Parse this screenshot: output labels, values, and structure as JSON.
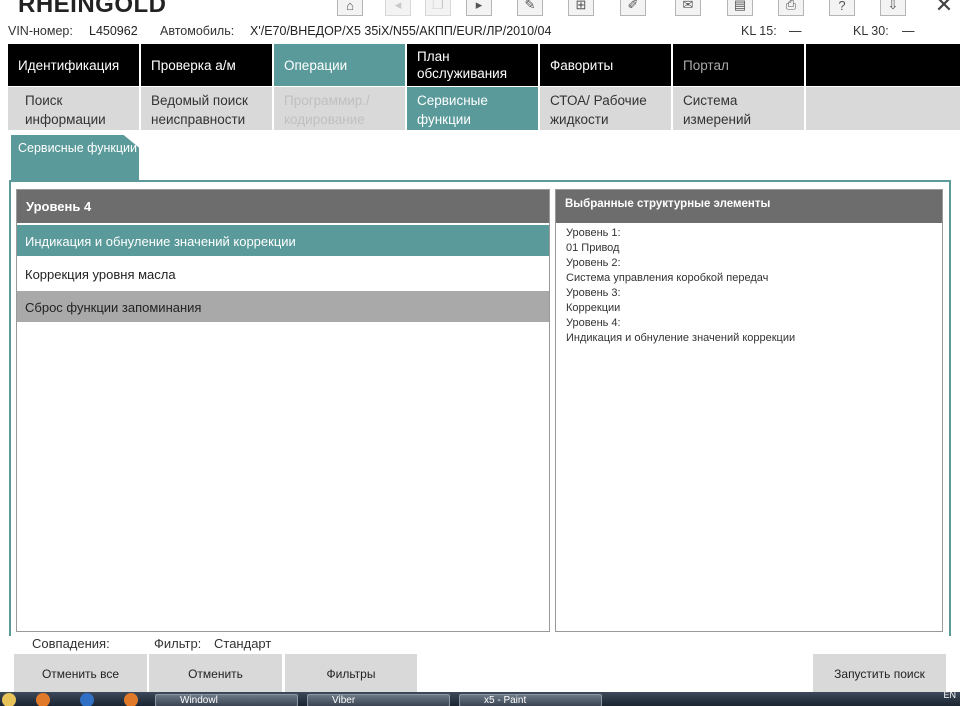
{
  "app": {
    "title": "RHEINGOLD"
  },
  "toolbar": {
    "buttons": [
      {
        "name": "home-icon",
        "glyph": "⌂"
      },
      {
        "name": "back-icon",
        "glyph": "◂"
      },
      {
        "name": "copy-icon",
        "glyph": "❐"
      },
      {
        "name": "forward-icon",
        "glyph": "▸"
      },
      {
        "name": "wrench-icon",
        "glyph": "✎"
      },
      {
        "name": "network-icon",
        "glyph": "⊞"
      },
      {
        "name": "edit-icon",
        "glyph": "✐"
      },
      {
        "name": "mail-icon",
        "glyph": "✉"
      },
      {
        "name": "document-icon",
        "glyph": "▤"
      },
      {
        "name": "print-icon",
        "glyph": "⎙"
      },
      {
        "name": "help-icon",
        "glyph": "?"
      },
      {
        "name": "download-icon",
        "glyph": "⇩"
      },
      {
        "name": "close-icon",
        "glyph": "✕"
      }
    ]
  },
  "vinbar": {
    "vin_label": "VIN-номер:",
    "vin_value": "L450962",
    "car_label": "Автомобиль:",
    "car_value": "X'/E70/ВНЕДОР/X5 35iX/N55/АКПП/EUR/ЛР/2010/04",
    "kl15_label": "KL 15:",
    "kl15_value": "—",
    "kl30_label": "KL 30:",
    "kl30_value": "—"
  },
  "main_tabs": [
    {
      "label": "Идентификация",
      "state": "normal"
    },
    {
      "label": "Проверка а/м",
      "state": "normal"
    },
    {
      "label": "Операции",
      "state": "active"
    },
    {
      "label": "План обслуживания",
      "state": "normal"
    },
    {
      "label": "Фавориты",
      "state": "normal"
    },
    {
      "label": "Портал",
      "state": "dim"
    }
  ],
  "sub_tabs": [
    {
      "label": "Поиск информации",
      "state": "normal"
    },
    {
      "label": "Ведомый поиск неисправности",
      "state": "normal"
    },
    {
      "label": "Программир./ кодирование",
      "state": "dim"
    },
    {
      "label": "Сервисные функции",
      "state": "active"
    },
    {
      "label": "СТОА/ Рабочие жидкости",
      "state": "normal"
    },
    {
      "label": "Система измерений",
      "state": "normal"
    }
  ],
  "folder_tab": {
    "label": "Сервисные функции"
  },
  "left_panel": {
    "header": "Уровень 4",
    "items": [
      {
        "label": "Индикация и обнуление значений коррекции",
        "state": "selected"
      },
      {
        "label": "Коррекция уровня масла",
        "state": "normal"
      },
      {
        "label": "Сброс функции запоминания",
        "state": "grey"
      }
    ]
  },
  "right_panel": {
    "header": "Выбранные структурные элементы",
    "lines": [
      "Уровень 1:",
      "01 Привод",
      "Уровень 2:",
      "Система управления коробкой передач",
      "Уровень 3:",
      "Коррекции",
      "Уровень 4:",
      "Индикация и обнуление значений коррекции"
    ]
  },
  "footer": {
    "matches_label": "Совпадения:",
    "filter_label": "Фильтр:",
    "filter_value": "Стандарт",
    "cancel_all": "Отменить все",
    "cancel": "Отменить",
    "filters": "Фильтры",
    "start_search": "Запустить поиск"
  },
  "taskbar": {
    "items": [
      {
        "label": "Windowl"
      },
      {
        "label": "Viber"
      },
      {
        "label": "x5 - Paint"
      }
    ],
    "tray": "EN"
  },
  "colors": {
    "accent": "#5a9a9a",
    "header_grey": "#6d6d6d",
    "nav_black": "#000000",
    "subnav_grey": "#d9d9d9"
  }
}
